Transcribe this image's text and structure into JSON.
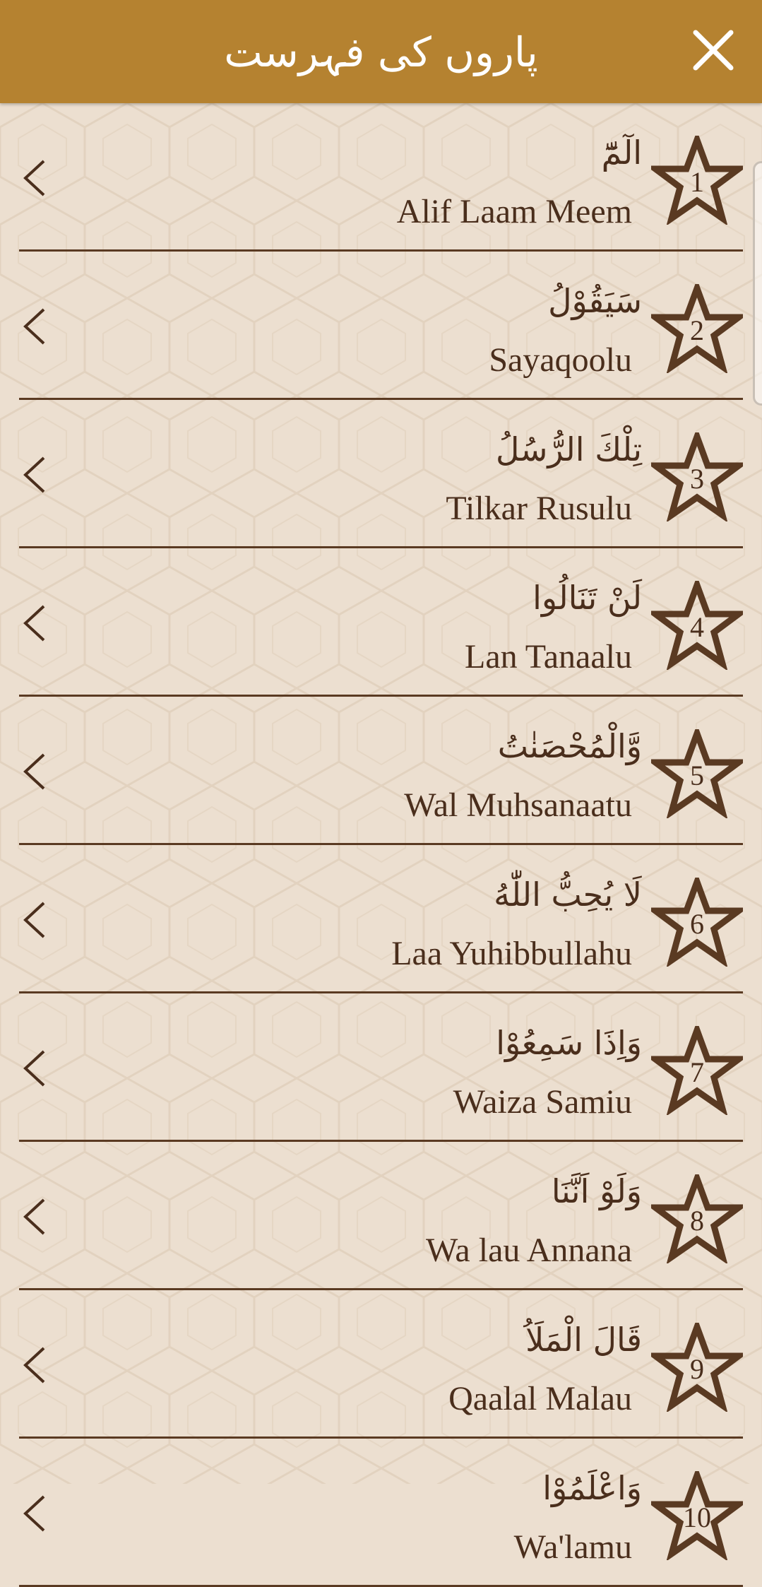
{
  "header": {
    "title": "پاروں کی فہرست",
    "close_icon": "close-icon"
  },
  "colors": {
    "header_bg": "#b58230",
    "page_bg": "#ecdfd0",
    "text_brown": "#4a2e1c",
    "divider": "#5a3a22"
  },
  "paras": [
    {
      "number": "1",
      "arabic": "الٓمّٓ",
      "latin": "Alif Laam Meem"
    },
    {
      "number": "2",
      "arabic": "سَيَقُوْلُ",
      "latin": "Sayaqoolu"
    },
    {
      "number": "3",
      "arabic": "تِلْكَ الرُّسُلُ",
      "latin": "Tilkar Rusulu"
    },
    {
      "number": "4",
      "arabic": "لَنْ تَنَالُوا",
      "latin": "Lan Tanaalu"
    },
    {
      "number": "5",
      "arabic": "وَّالْمُحْصَنٰتُ",
      "latin": "Wal Muhsanaatu"
    },
    {
      "number": "6",
      "arabic": "لَا يُحِبُّ اللّٰهُ",
      "latin": "Laa Yuhibbullahu"
    },
    {
      "number": "7",
      "arabic": "وَاِذَا سَمِعُوْا",
      "latin": "Waiza Samiu"
    },
    {
      "number": "8",
      "arabic": "وَلَوْ اَنَّنَا",
      "latin": "Wa lau Annana"
    },
    {
      "number": "9",
      "arabic": "قَالَ الْمَلَاُ",
      "latin": "Qaalal Malau"
    },
    {
      "number": "10",
      "arabic": "وَاعْلَمُوْا",
      "latin": "Wa'lamu"
    }
  ]
}
